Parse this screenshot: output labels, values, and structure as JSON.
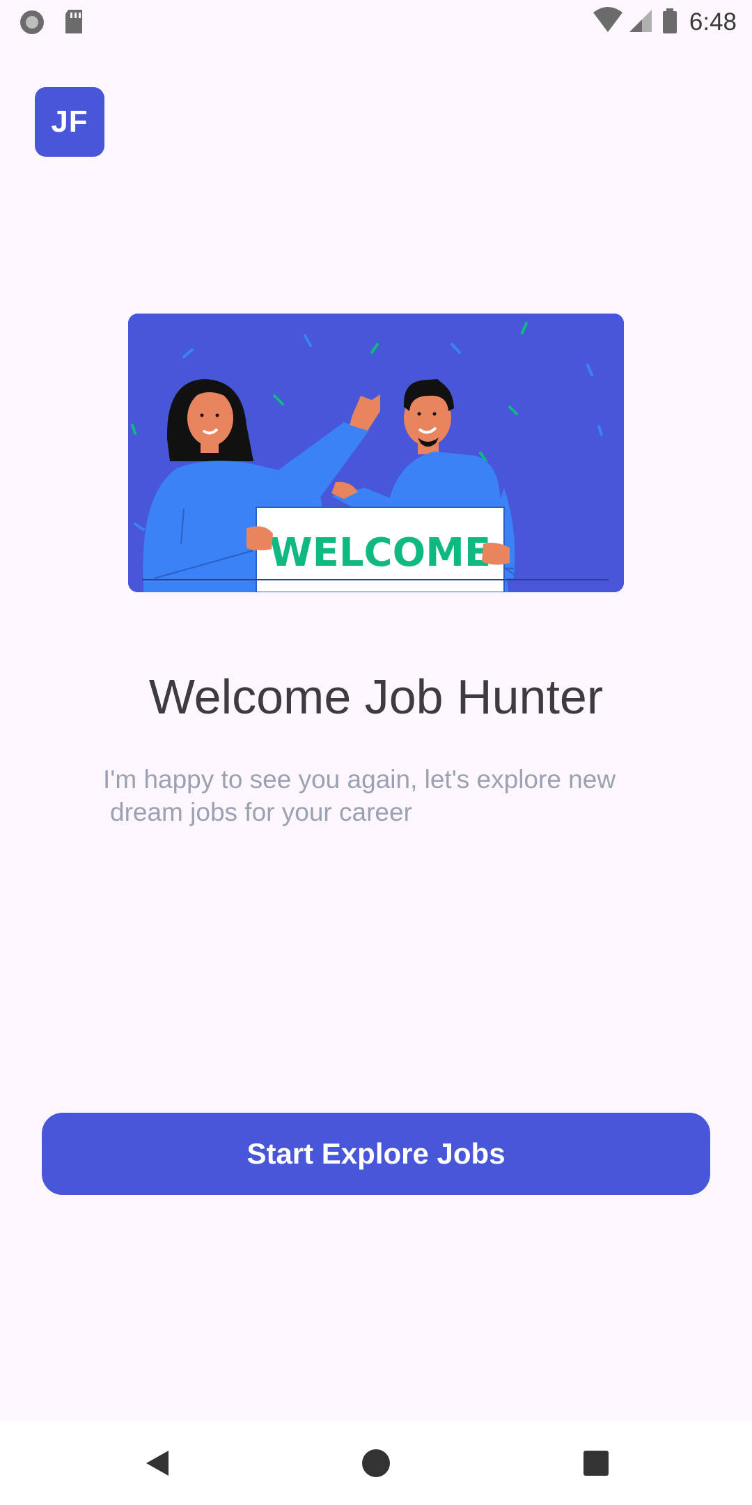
{
  "status_bar": {
    "time": "6:48",
    "left_icons": [
      "record-icon",
      "sd-card-icon"
    ],
    "right_icons": [
      "wifi-icon",
      "cell-signal-icon",
      "battery-icon"
    ]
  },
  "app": {
    "logo_text": "JF",
    "hero_sign_text": "WELCOME",
    "title": "Welcome Job Hunter",
    "subtitle_line1": "I'm happy to see you again, let's explore new",
    "subtitle_line2": "dream jobs for your career",
    "cta_label": "Start Explore Jobs"
  },
  "nav_bar": {
    "icons": [
      "back-icon",
      "home-icon",
      "recents-icon"
    ]
  },
  "colors": {
    "background": "#fdf6fc",
    "primary": "#4857d8",
    "shirt": "#3b82f6",
    "sign_text": "#10b981",
    "title": "#3d3a40",
    "subtitle": "#9aa1b3"
  }
}
